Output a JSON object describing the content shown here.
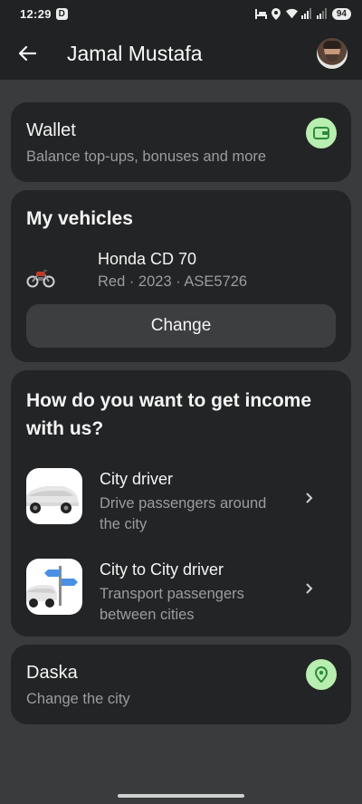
{
  "status_bar": {
    "time": "12:29",
    "d_badge": "D",
    "battery": "94"
  },
  "app_bar": {
    "title": "Jamal Mustafa"
  },
  "wallet": {
    "title": "Wallet",
    "subtitle": "Balance top-ups, bonuses and more",
    "icon": "wallet-icon",
    "badge_color": "#b8eeb0"
  },
  "vehicles": {
    "title": "My vehicles",
    "vehicle_name": "Honda CD 70",
    "vehicle_detail": "Red · 2023 · ASE5726",
    "change_label": "Change"
  },
  "income": {
    "question": "How do you want to get income with us?",
    "options": [
      {
        "title": "City driver",
        "desc": "Drive passengers around the city",
        "icon": "car-icon"
      },
      {
        "title": "City to City driver",
        "desc": "Transport passengers between cities",
        "icon": "car-signpost-icon"
      }
    ]
  },
  "city": {
    "title": "Daska",
    "subtitle": "Change the city",
    "icon": "location-pin-icon",
    "badge_color": "#b8eeb0"
  },
  "colors": {
    "background": "#3a3b3d",
    "card": "#232425",
    "header": "#212223",
    "accent_green": "#b8eeb0",
    "accent_green_dark": "#2f8a3b"
  }
}
